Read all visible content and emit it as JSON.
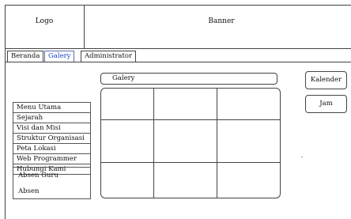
{
  "header": {
    "logo": "Logo",
    "banner": "Banner"
  },
  "nav": {
    "tabs": [
      "Beranda",
      "Galery",
      "Administrator"
    ],
    "active": "Galery"
  },
  "sidebar": {
    "menu": [
      "Menu Utama",
      "Sejarah",
      "Visi dan Misi",
      "Struktur Organisasi",
      "Peta Lokasi",
      "Web Programmer",
      "Hubungi Kami"
    ],
    "absen": [
      "Absen Guru",
      "Absen"
    ]
  },
  "main": {
    "galery_title": "Galery",
    "grid": {
      "rows": 3,
      "cols": 3
    }
  },
  "right": {
    "kalender": "Kalender",
    "jam": "Jam"
  },
  "colors": {
    "active_tab": "#1a3cc8",
    "border": "#444444"
  }
}
